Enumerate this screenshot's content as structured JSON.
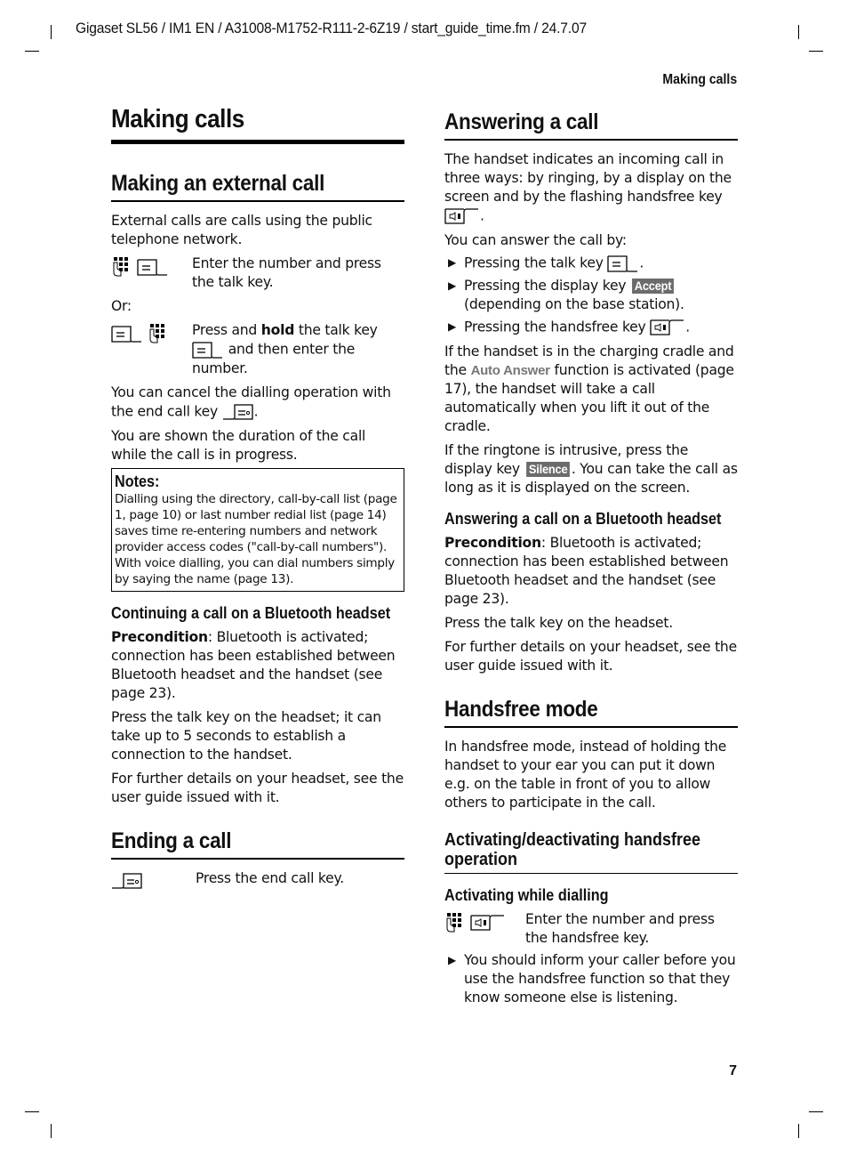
{
  "header": {
    "doc_line": "Gigaset SL56 / IM1 EN / A31008-M1752-R111-2-6Z19 / start_guide_time.fm / 24.7.07",
    "running_head": "Making calls",
    "page_number": "7"
  },
  "left": {
    "title": "Making calls",
    "external": {
      "heading": "Making an external call",
      "intro": "External calls are calls using the public telephone network.",
      "step1_icons": [
        "keypad-icon",
        "talk-key-icon"
      ],
      "step1_text": "Enter the number and press the talk key.",
      "or": "Or:",
      "step2_icons": [
        "talk-key-icon",
        "keypad-icon"
      ],
      "step2_pre": "Press and ",
      "step2_bold": "hold",
      "step2_mid": " the talk key",
      "step2_post": " and then enter the number.",
      "cancel_text": "You can cancel the dialling operation with the end call key",
      "duration_text": "You are shown the duration of the call while the call is in progress."
    },
    "notes": {
      "title": "Notes:",
      "items": [
        "Dialling using the directory, call-by-call list (page 1, page 10) or last number redial list (page 14) saves time re-entering numbers and network provider access codes (\"call-by-call numbers\").",
        "With voice dialling, you can dial numbers simply by saying the name (page 13)."
      ]
    },
    "bluetooth": {
      "heading": "Continuing a call on a Bluetooth headset",
      "precondition_label": "Precondition",
      "precondition_text": ": Bluetooth is activated; connection has been established between Bluetooth headset and the handset (see page 23).",
      "p2": "Press the talk key on the headset; it can take up to 5 seconds to establish a connection to the handset.",
      "p3": "For further details on your headset, see the user guide issued with it."
    },
    "ending": {
      "heading": "Ending a call",
      "icon": "end-call-key-icon",
      "text": "Press the end call key."
    }
  },
  "right": {
    "answering": {
      "heading": "Answering a call",
      "intro_pre": "The handset indicates an incoming call in three ways: by ringing, by a display on the screen and by the flashing handsfree key",
      "answer_by": "You can answer the call by:",
      "bullets": [
        {
          "pre": "Pressing the talk key",
          "key": "talk-key-icon"
        },
        {
          "pre": "Pressing the display key ",
          "display_key": "Accept",
          "post": " (depending on the base station)."
        },
        {
          "pre": "Pressing the handsfree key",
          "key": "handsfree-key-icon"
        }
      ],
      "auto_pre": "If the handset is in the charging cradle and the ",
      "auto_menu": "Auto Answer",
      "auto_post": " function is activated (page 17), the handset will take a call automatically when you lift it out of the cradle.",
      "silence_pre": "If the ringtone is intrusive, press the display key ",
      "silence_key": "Silence",
      "silence_post": ". You can take the call as long as it is displayed on the screen."
    },
    "bluetooth": {
      "heading": "Answering a call on a Bluetooth headset",
      "precondition_label": "Precondition",
      "precondition_text": ": Bluetooth is activated; connection has been established between Bluetooth headset and the handset (see page 23).",
      "p2": "Press the talk key on the headset.",
      "p3": "For further details on your headset, see the user guide issued with it."
    },
    "handsfree": {
      "heading": "Handsfree mode",
      "intro": "In handsfree mode, instead of holding the handset to your ear you can put it down e.g. on the table in front of you to allow others to participate in the call.",
      "sub_heading": "Activating/deactivating handsfree operation",
      "dialling_heading": "Activating while dialling",
      "step_text": "Enter the number and press the handsfree key.",
      "bullet": "You should inform your caller before you use the handsfree function so that they know someone else is listening."
    }
  }
}
